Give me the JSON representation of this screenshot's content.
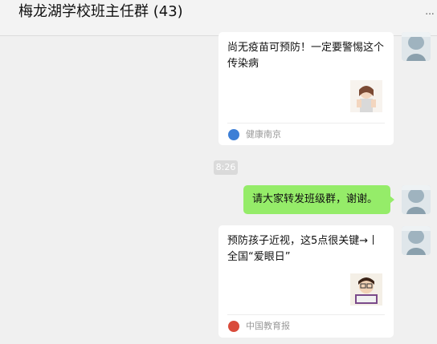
{
  "header": {
    "title": "梅龙湖学校班主任群 (43)",
    "more_label": "..."
  },
  "messages": [
    {
      "type": "card",
      "text": "尚无疫苗可预防！一定要警惕这个传染病",
      "source": "健康南京"
    },
    {
      "type": "time",
      "text": "8:26"
    },
    {
      "type": "text",
      "text": "请大家转发班级群，谢谢。"
    },
    {
      "type": "card",
      "text": "预防孩子近视，这5点很关键→丨全国“爱眼日”",
      "source": "中国教育报"
    }
  ],
  "colors": {
    "window_bg": "#f0f0f0",
    "bubble_sent": "#95ec69",
    "card_bg": "#ffffff",
    "source_text": "#999999"
  }
}
